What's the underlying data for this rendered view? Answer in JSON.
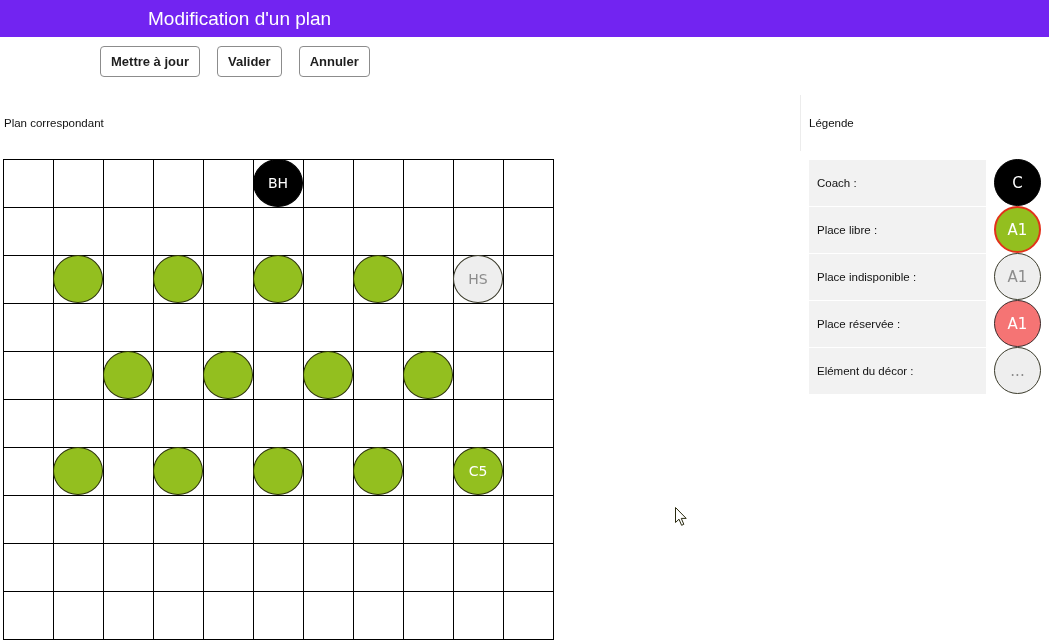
{
  "window": {
    "title": "Modification d'un plan"
  },
  "toolbar": {
    "buttons": [
      {
        "label": "Mettre à jour"
      },
      {
        "label": "Valider"
      },
      {
        "label": "Annuler"
      }
    ]
  },
  "plan": {
    "title": "Plan correspondant",
    "rows": [
      {
        "cells": [
          {
            "kind": "empty"
          },
          {
            "kind": "empty"
          },
          {
            "kind": "empty"
          },
          {
            "kind": "empty"
          },
          {
            "kind": "empty"
          },
          {
            "kind": "coach",
            "label": "BH"
          },
          {
            "kind": "empty"
          },
          {
            "kind": "empty"
          },
          {
            "kind": "empty"
          },
          {
            "kind": "empty"
          },
          {
            "kind": "empty"
          }
        ]
      },
      {
        "cells": [
          {
            "kind": "empty"
          },
          {
            "kind": "empty"
          },
          {
            "kind": "empty"
          },
          {
            "kind": "empty"
          },
          {
            "kind": "empty"
          },
          {
            "kind": "empty"
          },
          {
            "kind": "empty"
          },
          {
            "kind": "empty"
          },
          {
            "kind": "empty"
          },
          {
            "kind": "empty"
          },
          {
            "kind": "empty"
          }
        ]
      },
      {
        "cells": [
          {
            "kind": "empty"
          },
          {
            "kind": "free"
          },
          {
            "kind": "empty"
          },
          {
            "kind": "free"
          },
          {
            "kind": "empty"
          },
          {
            "kind": "free"
          },
          {
            "kind": "empty"
          },
          {
            "kind": "free"
          },
          {
            "kind": "empty"
          },
          {
            "kind": "unavailable",
            "label": "HS"
          },
          {
            "kind": "empty"
          }
        ]
      },
      {
        "cells": [
          {
            "kind": "empty"
          },
          {
            "kind": "empty"
          },
          {
            "kind": "empty"
          },
          {
            "kind": "empty"
          },
          {
            "kind": "empty"
          },
          {
            "kind": "empty"
          },
          {
            "kind": "empty"
          },
          {
            "kind": "empty"
          },
          {
            "kind": "empty"
          },
          {
            "kind": "empty"
          },
          {
            "kind": "empty"
          }
        ]
      },
      {
        "cells": [
          {
            "kind": "empty"
          },
          {
            "kind": "empty"
          },
          {
            "kind": "free"
          },
          {
            "kind": "empty"
          },
          {
            "kind": "free"
          },
          {
            "kind": "empty"
          },
          {
            "kind": "free"
          },
          {
            "kind": "empty"
          },
          {
            "kind": "free"
          },
          {
            "kind": "empty"
          },
          {
            "kind": "empty"
          }
        ]
      },
      {
        "cells": [
          {
            "kind": "empty"
          },
          {
            "kind": "empty"
          },
          {
            "kind": "empty"
          },
          {
            "kind": "empty"
          },
          {
            "kind": "empty"
          },
          {
            "kind": "empty"
          },
          {
            "kind": "empty"
          },
          {
            "kind": "empty"
          },
          {
            "kind": "empty"
          },
          {
            "kind": "empty"
          },
          {
            "kind": "empty"
          }
        ]
      },
      {
        "cells": [
          {
            "kind": "empty"
          },
          {
            "kind": "free"
          },
          {
            "kind": "empty"
          },
          {
            "kind": "free"
          },
          {
            "kind": "empty"
          },
          {
            "kind": "free"
          },
          {
            "kind": "empty"
          },
          {
            "kind": "free"
          },
          {
            "kind": "empty"
          },
          {
            "kind": "free",
            "label": "C5"
          },
          {
            "kind": "empty"
          }
        ]
      },
      {
        "cells": [
          {
            "kind": "empty"
          },
          {
            "kind": "empty"
          },
          {
            "kind": "empty"
          },
          {
            "kind": "empty"
          },
          {
            "kind": "empty"
          },
          {
            "kind": "empty"
          },
          {
            "kind": "empty"
          },
          {
            "kind": "empty"
          },
          {
            "kind": "empty"
          },
          {
            "kind": "empty"
          },
          {
            "kind": "empty"
          }
        ]
      },
      {
        "cells": [
          {
            "kind": "empty"
          },
          {
            "kind": "empty"
          },
          {
            "kind": "empty"
          },
          {
            "kind": "empty"
          },
          {
            "kind": "empty"
          },
          {
            "kind": "empty"
          },
          {
            "kind": "empty"
          },
          {
            "kind": "empty"
          },
          {
            "kind": "empty"
          },
          {
            "kind": "empty"
          },
          {
            "kind": "empty"
          }
        ]
      },
      {
        "cells": [
          {
            "kind": "empty"
          },
          {
            "kind": "empty"
          },
          {
            "kind": "empty"
          },
          {
            "kind": "empty"
          },
          {
            "kind": "empty"
          },
          {
            "kind": "empty"
          },
          {
            "kind": "empty"
          },
          {
            "kind": "empty"
          },
          {
            "kind": "empty"
          },
          {
            "kind": "empty"
          },
          {
            "kind": "empty"
          }
        ]
      }
    ]
  },
  "legend": {
    "title": "Légende",
    "items": [
      {
        "label": "Coach :",
        "kind": "coach",
        "sample": "C"
      },
      {
        "label": "Place libre :",
        "kind": "free",
        "sample": "A1"
      },
      {
        "label": "Place indisponible :",
        "kind": "unavailable",
        "sample": "A1"
      },
      {
        "label": "Place réservée :",
        "kind": "reserved",
        "sample": "A1"
      },
      {
        "label": "Elément du décor :",
        "kind": "decor",
        "sample": "..."
      }
    ]
  }
}
